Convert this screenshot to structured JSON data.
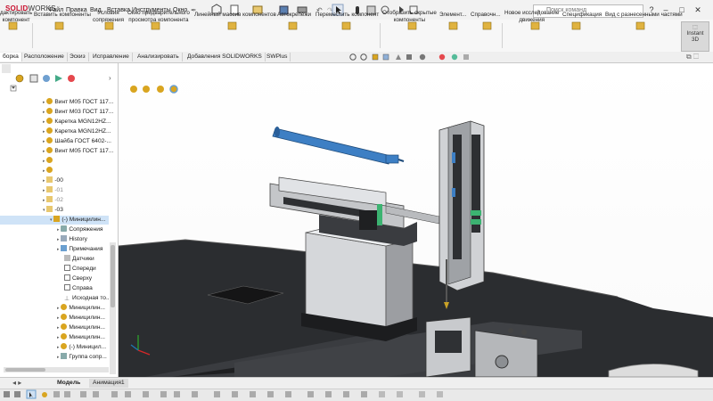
{
  "app": {
    "logo_main": "SOLID",
    "logo_sub": "WORKS"
  },
  "menu": [
    "Файл",
    "Правка",
    "Вид",
    "Вставка",
    "Инструменты",
    "Окно"
  ],
  "search": {
    "placeholder": "Поиск команд"
  },
  "commands": [
    "дактировать\nкомпонент",
    "Вставить компоненты",
    "Условия\nсопряжения",
    "Окно предварительного\nпросмотра компонента",
    "Линейный массив компонентов",
    "Автокрепежи",
    "Переместить компонент",
    "Отобразить скрытые\nкомпоненты",
    "Элемент...",
    "Справочн...",
    "Новое исследование\nдвижения",
    "Спецификация",
    "Вид с разнесенными частями"
  ],
  "instant3d": "Instant\n3D",
  "tabs": [
    "борка",
    "Расположение",
    "Эскиз",
    "Исправление",
    "Анализировать",
    "Добавления SOLIDWORKS",
    "SWPlus"
  ],
  "tree": [
    {
      "indent": 50,
      "icon": "part",
      "label": "Винт M05 ГОСТ 117..."
    },
    {
      "indent": 50,
      "icon": "part",
      "label": "Винт M03 ГОСТ 117..."
    },
    {
      "indent": 50,
      "icon": "part",
      "label": "Каретка MGN12HZ..."
    },
    {
      "indent": 50,
      "icon": "part",
      "label": "Каретка MGN12HZ..."
    },
    {
      "indent": 50,
      "icon": "part",
      "label": "Шайба ГОСТ 6402-..."
    },
    {
      "indent": 50,
      "icon": "part",
      "label": "Винт M05 ГОСТ 117..."
    },
    {
      "indent": 50,
      "icon": "part",
      "label": ""
    },
    {
      "indent": 50,
      "icon": "folder",
      "label": "-00"
    },
    {
      "indent": 50,
      "icon": "folder",
      "label": "-01"
    },
    {
      "indent": 50,
      "icon": "folder",
      "label": "-02"
    },
    {
      "indent": 50,
      "icon": "folder",
      "label": "-03"
    },
    {
      "indent": 58,
      "icon": "asm",
      "label": "(-) Миницилин..."
    },
    {
      "indent": 66,
      "icon": "mate",
      "label": "Сопряжения"
    },
    {
      "indent": 66,
      "icon": "history",
      "label": "History"
    },
    {
      "indent": 66,
      "icon": "note",
      "label": "Примечания"
    },
    {
      "indent": 66,
      "icon": "sensor",
      "label": "Датчики"
    },
    {
      "indent": 66,
      "icon": "plane",
      "label": "Спереди"
    },
    {
      "indent": 66,
      "icon": "plane",
      "label": "Сверху"
    },
    {
      "indent": 66,
      "icon": "plane",
      "label": "Справа"
    },
    {
      "indent": 66,
      "icon": "origin",
      "label": "Исходная то..."
    },
    {
      "indent": 66,
      "icon": "part",
      "label": "Миницилин..."
    },
    {
      "indent": 66,
      "icon": "part",
      "label": "Миницилин..."
    },
    {
      "indent": 66,
      "icon": "part",
      "label": "Миницилин..."
    },
    {
      "indent": 66,
      "icon": "part",
      "label": "Миницилин..."
    },
    {
      "indent": 66,
      "icon": "part",
      "label": "(-) Миницил..."
    },
    {
      "indent": 66,
      "icon": "mate",
      "label": "Группа сопр..."
    }
  ],
  "bottom_tabs": [
    "Модель",
    "Анимация1"
  ],
  "colors": {
    "accent_red": "#c8102e",
    "part_yellow": "#d9a520",
    "cylinder_blue": "#3d7fc4",
    "machine_dark": "#2b2d30"
  }
}
